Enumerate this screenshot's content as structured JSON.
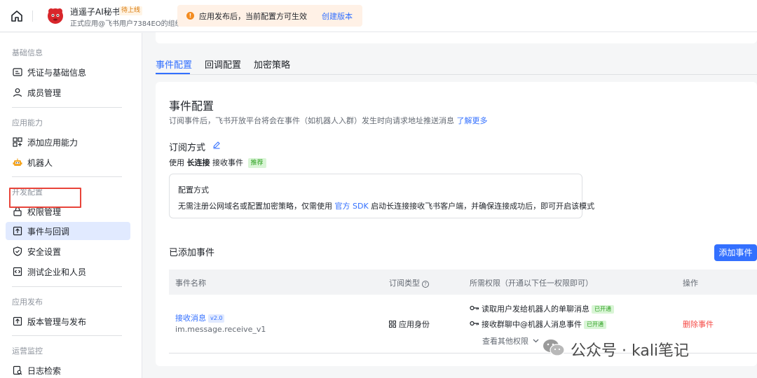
{
  "topbar": {
    "app_name": "逍遥子AI秘书",
    "app_status": "待上线",
    "app_org": "正式应用@飞书用户7384EO的组织",
    "notice_text": "应用发布后，当前配置方可生效",
    "notice_link": "创建版本"
  },
  "sidebar": {
    "groups": [
      {
        "title": "基础信息",
        "items": [
          "凭证与基础信息",
          "成员管理"
        ]
      },
      {
        "title": "应用能力",
        "items": [
          "添加应用能力",
          "机器人"
        ]
      },
      {
        "title": "开发配置",
        "items": [
          "权限管理",
          "事件与回调",
          "安全设置",
          "测试企业和人员"
        ]
      },
      {
        "title": "应用发布",
        "items": [
          "版本管理与发布"
        ]
      },
      {
        "title": "运营监控",
        "items": [
          "日志检索"
        ]
      }
    ],
    "active_item": "事件与回调"
  },
  "tabs": [
    "事件配置",
    "回调配置",
    "加密策略"
  ],
  "active_tab": "事件配置",
  "event_config": {
    "title": "事件配置",
    "desc": "订阅事件后，飞书开放平台将会在事件（如机器人入群）发生时向请求地址推送消息",
    "desc_link": "了解更多",
    "sub_mode_title": "订阅方式",
    "mode_prefix": "使用",
    "mode_bold": "长连接",
    "mode_suffix": "接收事件",
    "mode_tag": "推荐",
    "config_title": "配置方式",
    "config_text_before": "无需注册公网域名或配置加密策略，仅需使用",
    "config_link": "官方 SDK",
    "config_text_after": "启动长连接接收飞书客户端，并确保连接成功后，即可开启该模式"
  },
  "added_events": {
    "title": "已添加事件",
    "add_button": "添加事件",
    "columns": [
      "事件名称",
      "订阅类型",
      "所需权限（开通以下任一权限即可）",
      "操作"
    ],
    "rows": [
      {
        "name": "接收消息",
        "version": "v2.0",
        "id": "im.message.receive_v1",
        "sub_type": "应用身份",
        "permissions": [
          {
            "text": "读取用户发给机器人的单聊消息",
            "status": "已开通"
          },
          {
            "text": "接收群聊中@机器人消息事件",
            "status": "已开通"
          }
        ],
        "more_permissions": "查看其他权限",
        "action": "删除事件"
      }
    ]
  },
  "watermark": "公众号 · kali笔记"
}
